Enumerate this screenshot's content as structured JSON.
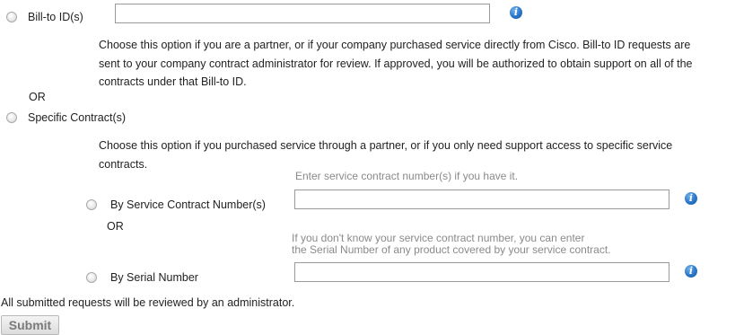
{
  "billto": {
    "label": "Bill-to ID(s)",
    "value": "",
    "info_icon": "info-icon",
    "desc_line1": "Choose this option if you are a partner, or if your company purchased service directly from Cisco. Bill-to ID requests are",
    "desc_line2": "sent to your company contract administrator for review. If approved, you will be authorized to obtain support on all of the",
    "desc_line3": "contracts under that Bill-to ID."
  },
  "or_label": "OR",
  "specific": {
    "label": "Specific Contract(s)",
    "desc_line1": "Choose this option if you purchased service through a partner, or if you only need support access to specific service",
    "desc_line2": "contracts.",
    "contract_hint": "Enter service contract number(s) if you have it.",
    "contract_label": "By Service Contract Number(s)",
    "contract_value": "",
    "or_label": "OR",
    "serial_hint_line1": "If you don't know your service contract number, you can enter",
    "serial_hint_line2": "the Serial Number of any product covered by your service contract.",
    "serial_label": "By Serial Number",
    "serial_value": ""
  },
  "footer_note": "All submitted requests will be reviewed by an administrator.",
  "submit_label": "Submit",
  "colors": {
    "info_icon": "#2a76c8",
    "hint_text": "#8a8a8a"
  }
}
